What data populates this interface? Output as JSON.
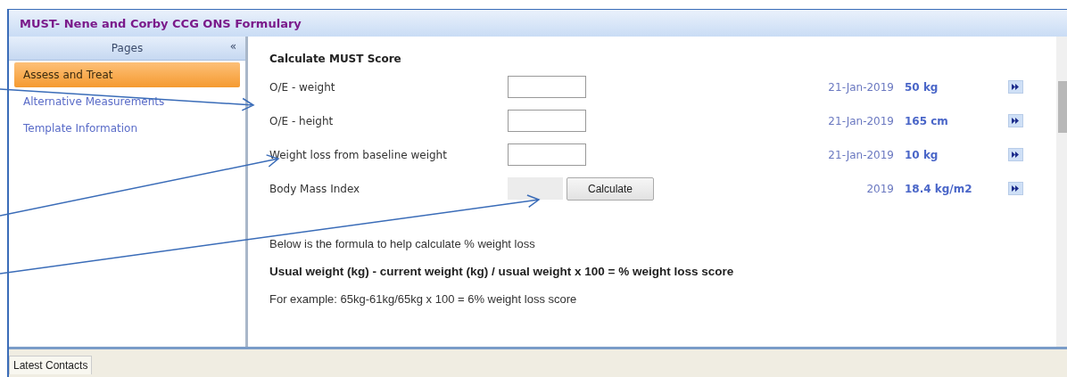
{
  "window": {
    "title": "MUST- Nene and Corby CCG ONS Formulary"
  },
  "sidebar": {
    "header": "Pages",
    "collapse": "«",
    "items": [
      {
        "label": "Assess and Treat",
        "selected": true
      },
      {
        "label": "Alternative Measurements",
        "selected": false
      },
      {
        "label": "Template Information",
        "selected": false
      }
    ]
  },
  "form": {
    "title": "Calculate MUST Score",
    "rows": [
      {
        "kind": "input",
        "label": "O/E - weight",
        "date": "21-Jan-2019",
        "value": "50 kg"
      },
      {
        "kind": "input",
        "label": "O/E - height",
        "date": "21-Jan-2019",
        "value": "165 cm"
      },
      {
        "kind": "input",
        "label": "Weight loss from baseline weight",
        "date": "21-Jan-2019",
        "value": "10 kg"
      },
      {
        "kind": "calculated",
        "label": "Body Mass Index",
        "button": "Calculate",
        "date": "2019",
        "value": "18.4 kg/m2"
      }
    ],
    "notes": [
      {
        "kind": "plain",
        "text": "Below is the formula to help calculate % weight loss"
      },
      {
        "kind": "bold",
        "text": "Usual weight (kg) - current weight (kg) / usual weight x 100 = % weight loss score"
      },
      {
        "kind": "plain",
        "text": "For example: 65kg-61kg/65kg x 100 = 6% weight loss score"
      }
    ]
  },
  "bottom_tabs": [
    {
      "label": "Latest Contacts",
      "selected": true
    }
  ]
}
